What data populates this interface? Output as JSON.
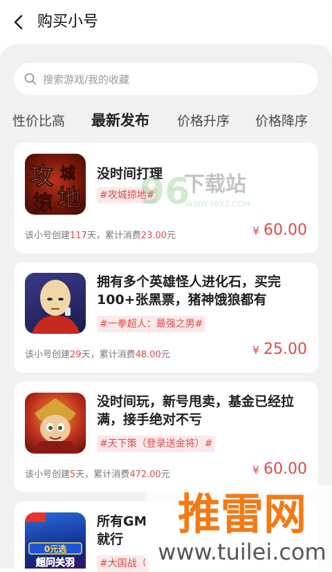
{
  "header": {
    "title": "购买小号"
  },
  "search": {
    "placeholder": "搜索游戏/我的收藏"
  },
  "tabs": [
    {
      "label": "性价比高",
      "active": false
    },
    {
      "label": "最新发布",
      "active": true
    },
    {
      "label": "价格升序",
      "active": false
    },
    {
      "label": "价格降序",
      "active": false
    }
  ],
  "listings": [
    {
      "title": "没时间打理",
      "tag": "#攻城掠地#",
      "meta_prefix": "该小号创建",
      "days": "117",
      "meta_mid": "天，累计消费",
      "spent": "23.00",
      "meta_suffix": "元",
      "currency": "¥",
      "price": "60.00",
      "icon": "siege-game-icon",
      "icon_text": [
        "攻",
        "城",
        "掠",
        "地"
      ]
    },
    {
      "title": "拥有多个英雄怪人进化石，买完100+张黑票，猪神饿狼都有",
      "tag": "#一拳超人：最强之男#",
      "meta_prefix": "该小号创建",
      "days": "29",
      "meta_mid": "天，累计消费",
      "spent": "48.00",
      "meta_suffix": "元",
      "currency": "¥",
      "price": "25.00",
      "icon": "one-punch-man-game-icon"
    },
    {
      "title": "没时间玩，新号甩卖，基金已经拉满，接手绝对不亏",
      "tag": "#天下策（登录送金将）#",
      "meta_prefix": "该小号创建",
      "days": "5",
      "meta_mid": "天，累计消费",
      "spent": "472.00",
      "meta_suffix": "元",
      "currency": "¥",
      "price": "60.00",
      "icon": "tianxiace-game-icon"
    },
    {
      "title": "所有GM",
      "title_line2": "就行",
      "tag": "#大国战（",
      "icon": "daguozhan-game-icon",
      "icon_badges": [
        "0元选",
        "超问关羽"
      ]
    }
  ],
  "watermarks": {
    "site_96": {
      "number": "96",
      "name": "下载站",
      "url": "WWW.96XZ.COM"
    },
    "tuilei": {
      "name": "推雷网",
      "url": "www.tuilei.com"
    }
  },
  "colors": {
    "accent": "#e04a4a",
    "panel_bg": "#f1f1f3",
    "tag_bg": "#fbeaea"
  }
}
